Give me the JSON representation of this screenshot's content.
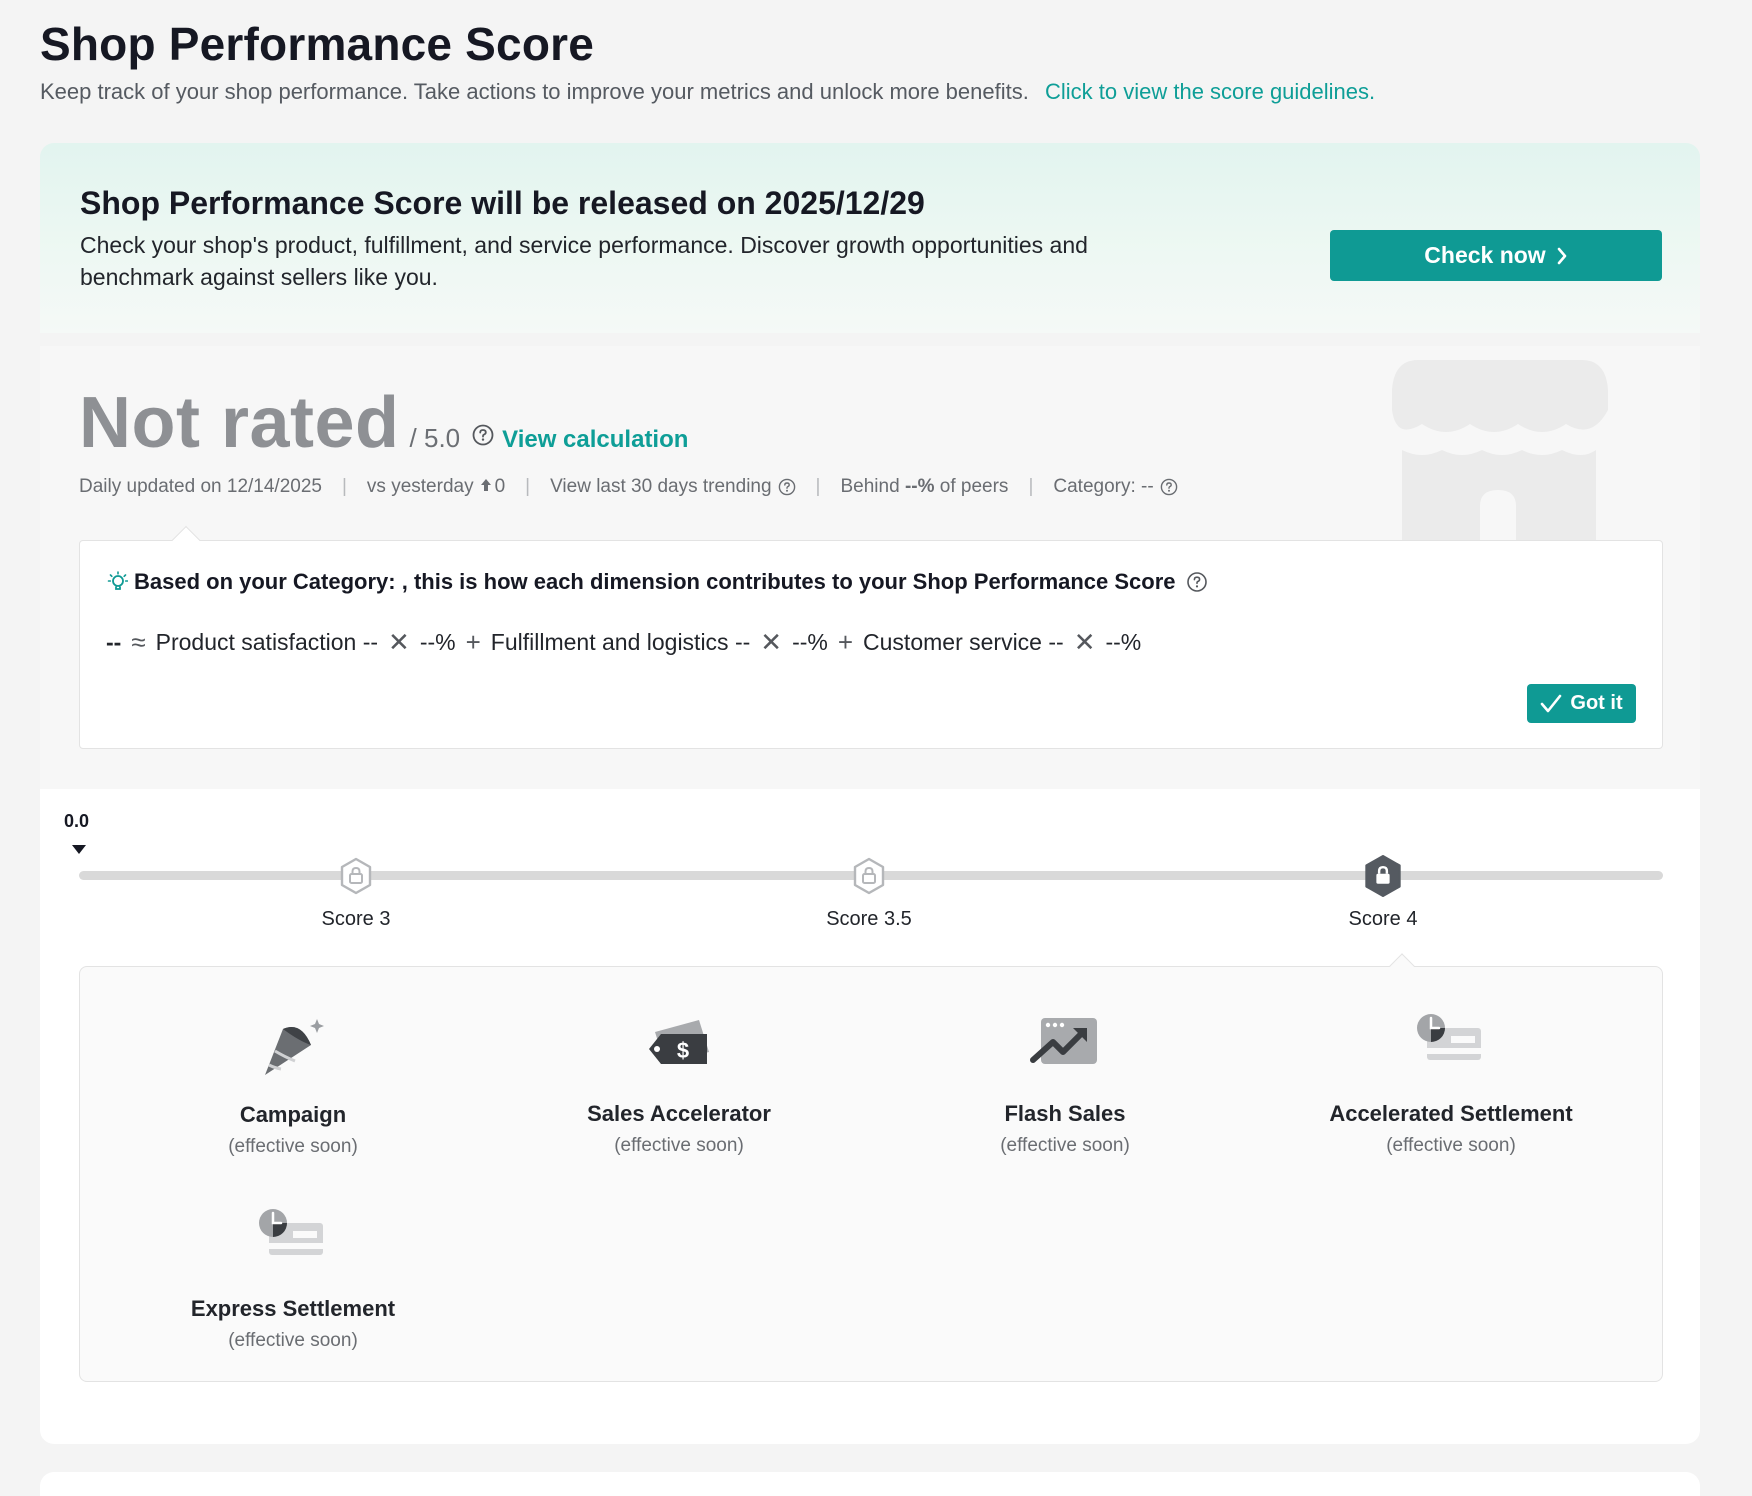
{
  "header": {
    "title": "Shop Performance Score",
    "description": "Keep track of your shop performance. Take actions to improve your metrics and unlock more benefits.",
    "guidelines_link": "Click to view the score guidelines."
  },
  "banner": {
    "title": "Shop Performance Score will be released on 2025/12/29",
    "description": "Check your shop's product, fulfillment, and service performance. Discover growth opportunities and benchmark against sellers like you.",
    "cta_label": "Check now"
  },
  "rating": {
    "score": "Not rated",
    "max": "/ 5.0",
    "view_calculation": "View calculation",
    "updated": "Daily updated on 12/14/2025",
    "vs_yesterday_label": "vs yesterday",
    "vs_yesterday_value": "0",
    "trending": "View last 30 days trending",
    "behind_prefix": "Behind",
    "behind_value": "--%",
    "behind_suffix": "of peers",
    "category": "Category: --"
  },
  "contribution": {
    "title": "Based on your Category: , this is how each dimension contributes to your Shop Performance Score",
    "result": "--",
    "approx": "≈",
    "dim1": "Product satisfaction --",
    "dim1_weight": "--%",
    "dim2": "Fulfillment and logistics --",
    "dim2_weight": "--%",
    "dim3": "Customer service --",
    "dim3_weight": "--%",
    "times": "✕",
    "plus": "+",
    "got_it": "Got it"
  },
  "progress": {
    "current_score": "0.0",
    "milestones": [
      {
        "label": "Score 3",
        "active": false
      },
      {
        "label": "Score 3.5",
        "active": false
      },
      {
        "label": "Score 4",
        "active": true
      }
    ]
  },
  "benefits": {
    "items": [
      {
        "name": "Campaign",
        "status": "(effective soon)",
        "icon": "party-popper-icon"
      },
      {
        "name": "Sales Accelerator",
        "status": "(effective soon)",
        "icon": "price-tag-icon"
      },
      {
        "name": "Flash Sales",
        "status": "(effective soon)",
        "icon": "trending-chart-icon"
      },
      {
        "name": "Accelerated Settlement",
        "status": "(effective soon)",
        "icon": "card-clock-icon"
      },
      {
        "name": "Express Settlement",
        "status": "(effective soon)",
        "icon": "card-clock-icon"
      }
    ]
  },
  "colors": {
    "accent": "#0f9a94",
    "banner_bg": "#e2f4ef",
    "muted_score": "#8e9094",
    "locked_badge": "#555a61"
  }
}
